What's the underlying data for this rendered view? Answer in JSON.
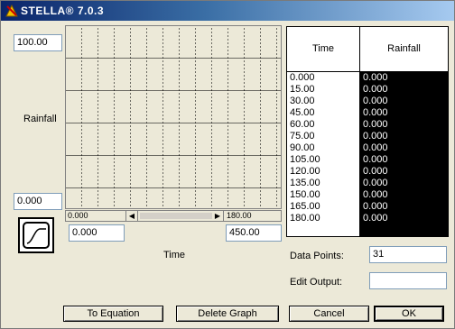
{
  "window": {
    "title": "STELLA® 7.0.3"
  },
  "graph": {
    "y_max": "100.00",
    "y_min": "0.000",
    "y_label": "Rainfall",
    "x_label": "Time",
    "x_min": "0.000",
    "x_max": "450.00",
    "scroll_start": "0.000",
    "scroll_end": "180.00"
  },
  "table": {
    "headers": [
      "Time",
      "Rainfall"
    ],
    "time": [
      "0.000",
      "15.00",
      "30.00",
      "45.00",
      "60.00",
      "75.00",
      "90.00",
      "105.00",
      "120.00",
      "135.00",
      "150.00",
      "165.00",
      "180.00"
    ],
    "rainfall": [
      "0.000",
      "0.000",
      "0.000",
      "0.000",
      "0.000",
      "0.000",
      "0.000",
      "0.000",
      "0.000",
      "0.000",
      "0.000",
      "0.000",
      "0.000"
    ]
  },
  "data_points": {
    "label": "Data Points:",
    "value": "31"
  },
  "edit_output": {
    "label": "Edit Output:",
    "value": ""
  },
  "buttons": {
    "to_equation": "To Equation",
    "delete_graph": "Delete Graph",
    "cancel": "Cancel",
    "ok": "OK"
  }
}
